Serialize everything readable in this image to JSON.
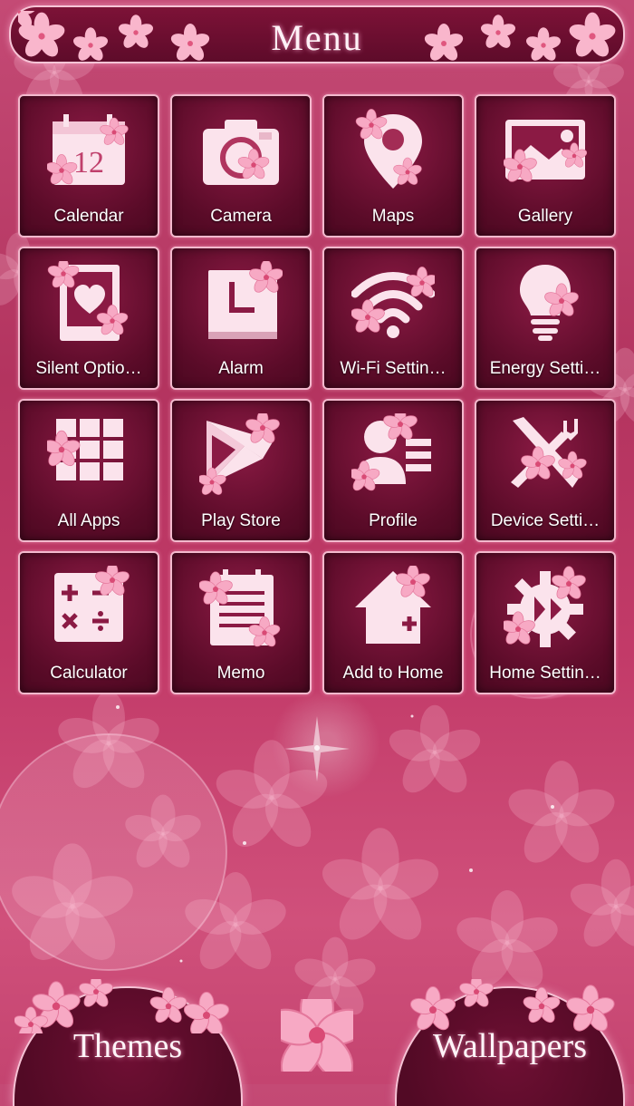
{
  "header": {
    "title": "Menu"
  },
  "apps": [
    {
      "label": "Calendar",
      "icon": "calendar-icon",
      "day": "12"
    },
    {
      "label": "Camera",
      "icon": "camera-icon"
    },
    {
      "label": "Maps",
      "icon": "map-pin-icon"
    },
    {
      "label": "Gallery",
      "icon": "gallery-icon"
    },
    {
      "label": "Silent Optio…",
      "icon": "silent-heart-icon"
    },
    {
      "label": "Alarm",
      "icon": "clock-icon"
    },
    {
      "label": "Wi-Fi Settin…",
      "icon": "wifi-icon"
    },
    {
      "label": "Energy Setti…",
      "icon": "lightbulb-icon"
    },
    {
      "label": "All Apps",
      "icon": "grid-icon"
    },
    {
      "label": "Play Store",
      "icon": "play-store-icon"
    },
    {
      "label": "Profile",
      "icon": "profile-icon"
    },
    {
      "label": "Device Setti…",
      "icon": "tools-icon"
    },
    {
      "label": "Calculator",
      "icon": "calculator-icon"
    },
    {
      "label": "Memo",
      "icon": "memo-icon"
    },
    {
      "label": "Add to Home",
      "icon": "add-home-icon"
    },
    {
      "label": "Home Settin…",
      "icon": "gear-icon"
    }
  ],
  "bottom": {
    "themes_label": "Themes",
    "wallpapers_label": "Wallpapers"
  },
  "colors": {
    "tile_border": "#f3b9cd",
    "icon_fill": "#fbe3ec",
    "flower": "#f7a9c4",
    "background": "#c03c68"
  }
}
